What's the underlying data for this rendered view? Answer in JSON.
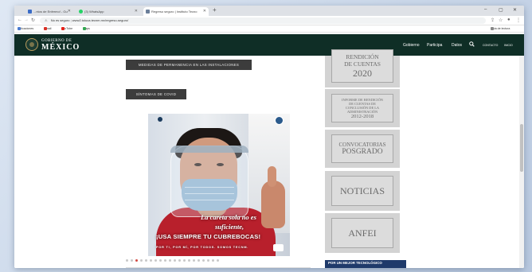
{
  "browser": {
    "tabs": [
      {
        "title": "...ntos de Enfermo! - Gu",
        "active": false,
        "favicon_color": "#3b6cc7"
      },
      {
        "title": "(3) WhatsApp",
        "active": false,
        "favicon_color": "#25d366"
      },
      {
        "title": "Regreso seguro | Instituto Tecno",
        "active": true,
        "favicon_color": "#6b7f9a"
      }
    ],
    "new_tab": "+",
    "window_controls": [
      "–",
      "▢",
      "✕"
    ],
    "security_label": "No es seguro",
    "url": "www2.toluca.tecnm.mx/regreso-seguro/",
    "bookmarks": [
      {
        "label": "Aplicaciones",
        "color": "#4a7bd0"
      },
      {
        "label": "Gmail",
        "color": "#d93025"
      },
      {
        "label": "YouTube",
        "color": "#e62117"
      },
      {
        "label": "Maps",
        "color": "#34a853"
      }
    ],
    "reading_list": "Lista de lectura"
  },
  "gob_header": {
    "logo_top": "GOBIERNO DE",
    "logo_main": "MÉXICO",
    "nav": [
      "Gobierno",
      "Participa",
      "Datos"
    ],
    "nav_small": [
      "CONTACTO",
      "INICIO"
    ]
  },
  "main": {
    "button_permanencia": "MEDIDAS DE PERMANENCIA EN LAS INSTALACIONES",
    "button_sintomas": "SÍNTOMAS DE COVID",
    "slide": {
      "line1": "La careta sola no es",
      "line2": "suficiente,",
      "line3": "¡USA SIEMPRE TU CUBREBOCAS!",
      "line4": "POR TI, POR MÍ, POR TODOS. SOMOS TECNM."
    },
    "slider_dots_count": 20,
    "slider_active_index": 2
  },
  "sidebar": {
    "rendicion": {
      "line1": "RENDICIÓN",
      "line2": "DE CUENTAS",
      "line3": "2020"
    },
    "informe": {
      "line1": "INFORME DE RENDICIÓN",
      "line2": "DE CUENTAS DE",
      "line3": "CONCLUSIÓN DE LA",
      "line4": "ADMINISTRACIÓN",
      "line5": "2012-2018"
    },
    "convocatorias": {
      "line1": "CONVOCATORIAS",
      "line2": "POSGRADO"
    },
    "noticias": "NOTICIAS",
    "anfei": "ANFEI",
    "mejor": "POR UN MEJOR TECNOLÓGICO"
  },
  "colors": {
    "gob_green": "#0f2e26",
    "dark_button": "#3c3c3c",
    "blue_box": "#1f3a6a",
    "slider_dot_active": "#d24a43"
  }
}
